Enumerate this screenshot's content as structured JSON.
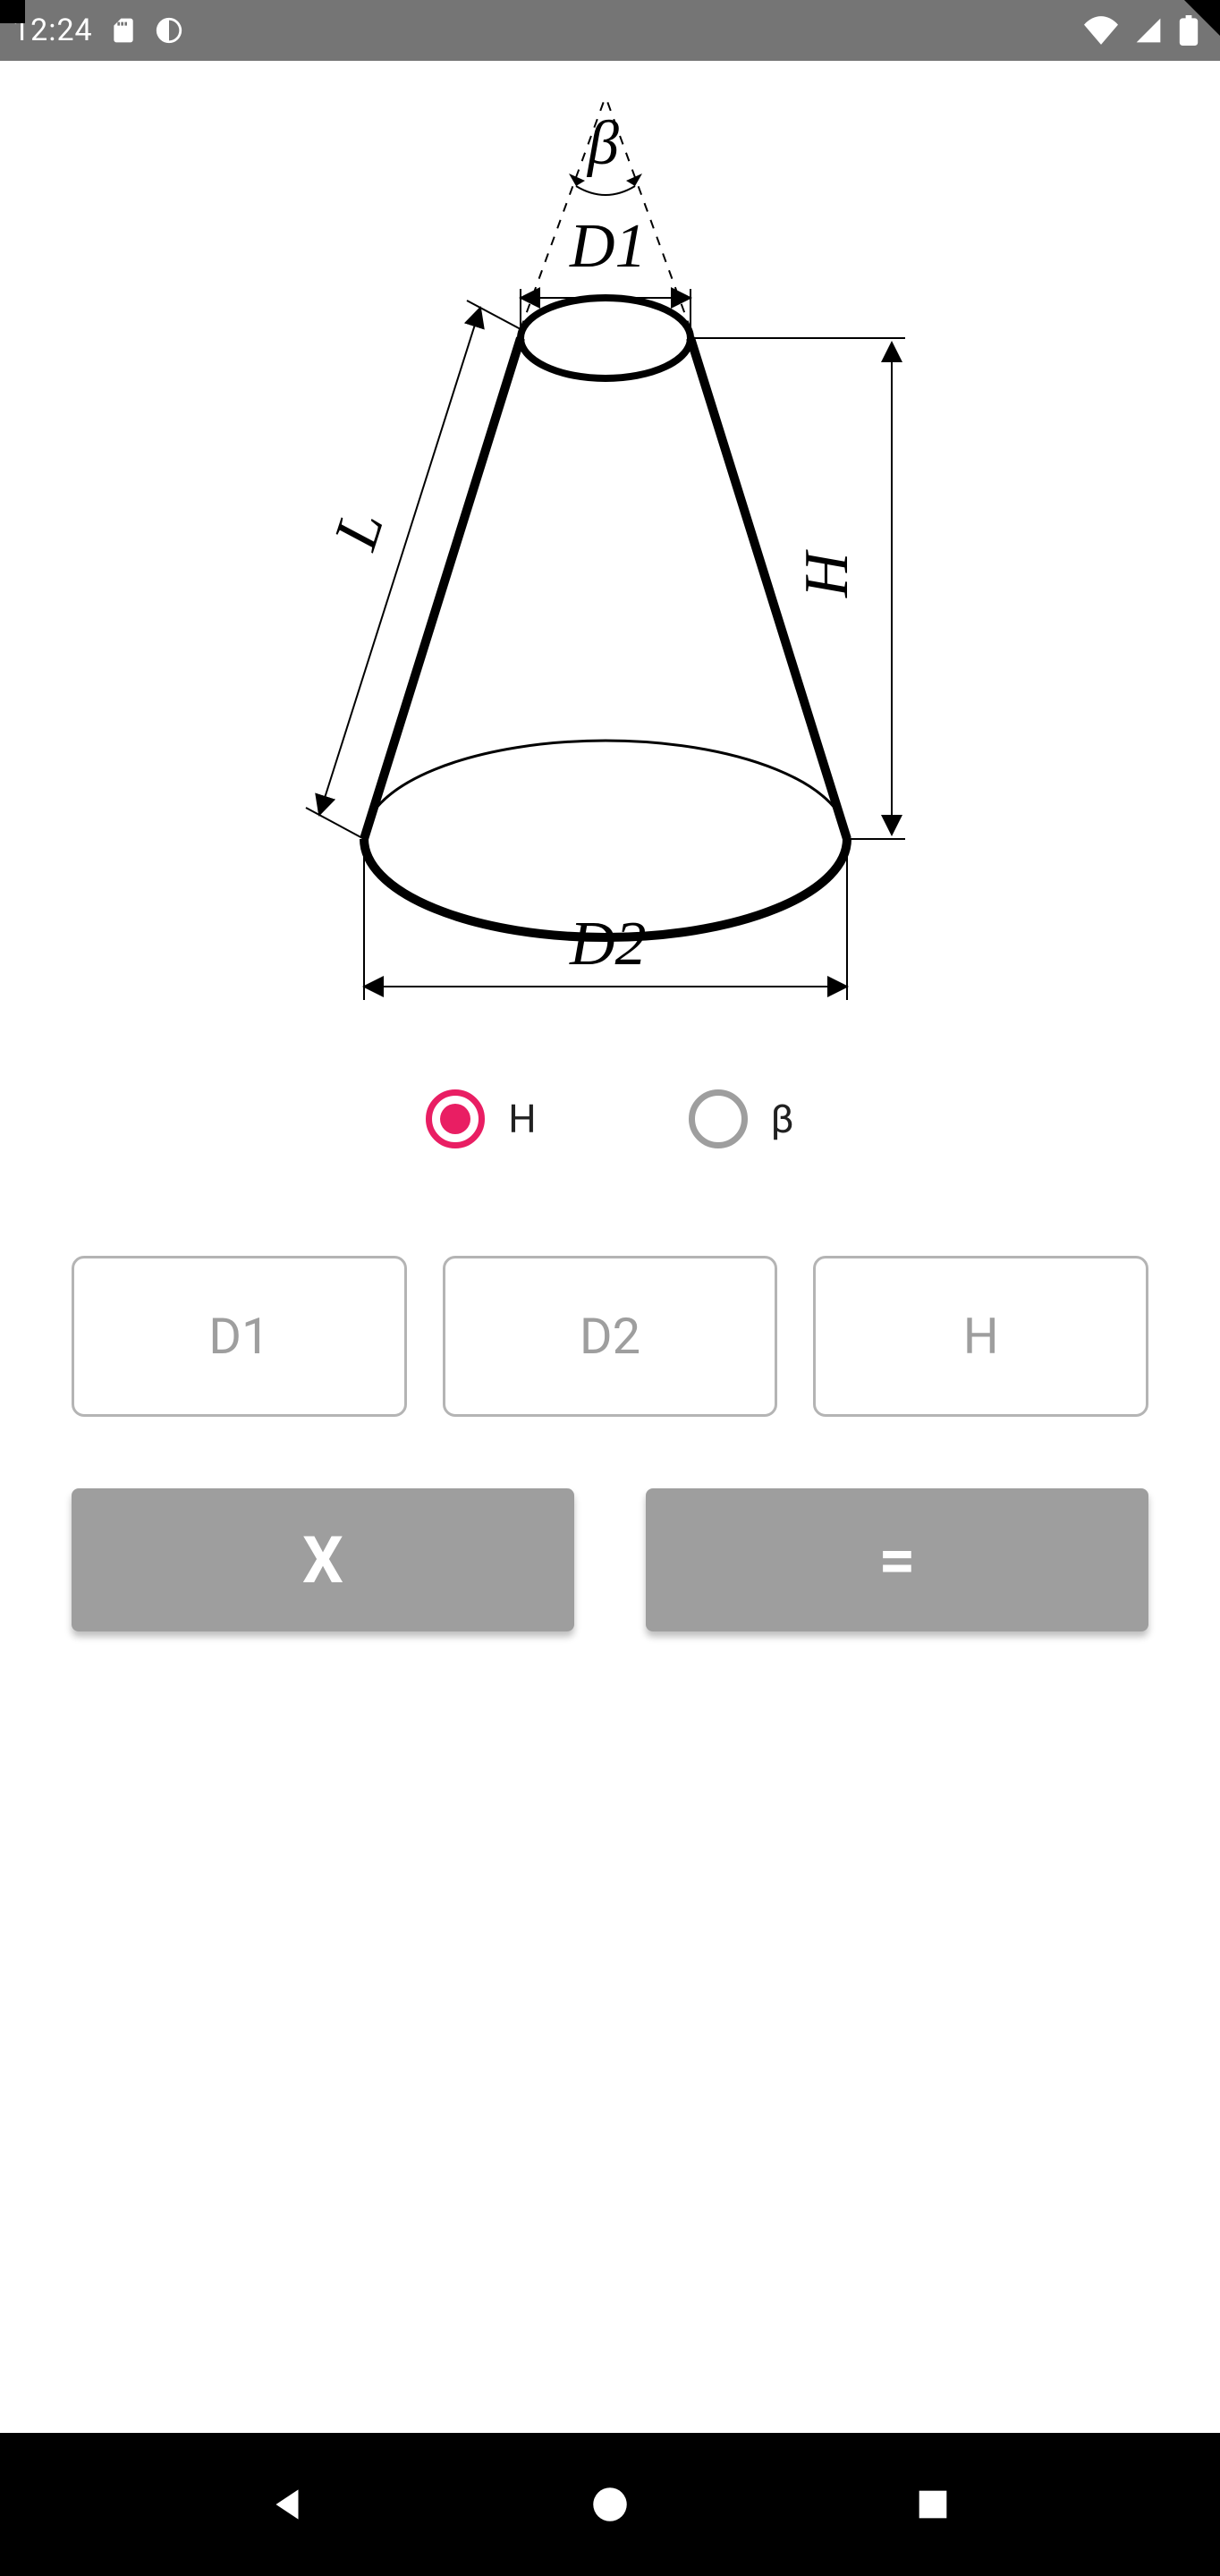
{
  "status": {
    "time": "12:24",
    "icons_left": [
      "sd-card-icon",
      "contrast-icon"
    ],
    "icons_right": [
      "wifi-icon",
      "signal-icon",
      "battery-icon"
    ]
  },
  "diagram": {
    "labels": {
      "beta": "β",
      "d1": "D1",
      "d2": "D2",
      "l": "L",
      "h": "H"
    }
  },
  "radios": {
    "option_h": {
      "label": "H",
      "selected": true
    },
    "option_beta": {
      "label": "β",
      "selected": false
    }
  },
  "inputs": {
    "d1": {
      "placeholder": "D1"
    },
    "d2": {
      "placeholder": "D2"
    },
    "h": {
      "placeholder": "H"
    }
  },
  "buttons": {
    "clear": "X",
    "equals": "="
  }
}
